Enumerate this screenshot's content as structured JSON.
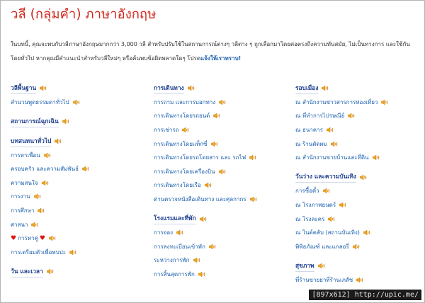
{
  "page": {
    "title": "วลี (กลุ่มคำ) ภาษาอังกฤษ",
    "intro_text": "ในบทนี้, คุณจะพบกับวลีภาษาอังกฤษมากกว่า 3,000 วลี สำหรับปรับใช้ในสถานการณ์ต่างๆ วลีต่าง ๆ ถูกเลือกมาโดยต่อตรงถึงความทันสมัย, ไม่เป็นทางการ และใช้กันโดยทั่วไป หากคุณมีคำแนะนำสำหรับวลีใหม่ๆ หรือค้นพบข้อผิดพลาดใดๆ โปรด",
    "report_link": "แจ้งให้เราทราบ!",
    "speaker_icon": "speaker-icon",
    "heading_color": "#1f3f8f",
    "link_color": "#1a5fae",
    "title_color": "#d0281e"
  },
  "columns": {
    "col1": {
      "h1": "วลีพื้นฐาน",
      "l1": "สำนวนพูดธรรมดาทั่วไป",
      "h2": "สถานการณ์ฉุกเฉิน",
      "h3": "บทสนทนาทั่วไป",
      "l2": "การหาเพื่อน",
      "l3": "ครอบครัว และความสัมพันธ์",
      "l4": "ความสนใจ",
      "l5": "การงาน",
      "l6": "การศึกษา",
      "l7": "ศาสนา",
      "l8": "การหาคู่",
      "l9": "การเตรียมตัวเพื่อพบปะ",
      "h4": "วัน และเวลา"
    },
    "col2": {
      "h1": "การเดินทาง",
      "l1": "การถาม และการบอกทาง",
      "l2": "การเดินทางโดยรถยนต์",
      "l3": "การเช่ารถ",
      "l4": "การเดินทางโดยแท็กซี่",
      "l5": "การเดินทางโดยรถโดยสาร และ รถไฟ",
      "l6": "การเดินทางโดยเครื่องบิน",
      "l7": "การเดินทางโดยเรือ",
      "l8": "ด่านตรวจหนังสือเดินทาง และศุลกากร",
      "h2": "โรงแรมและที่พัก",
      "l9": "การจอง",
      "l10": "การลงทะเบียนเข้าพัก",
      "l11": "ระหว่างการพัก",
      "l12": "การสิ้นสุดการพัก"
    },
    "col3": {
      "h1": "รอบเมือง",
      "l1": "ณ สำนักงานข่าวสารการท่องเที่ยว",
      "l2": "ณ ที่ทำการไปรษณีย์",
      "l3": "ณ ธนาคาร",
      "l4": "ณ ร้านตัดผม",
      "l5": "ณ สำนักงานขายบ้านและที่ดิน",
      "h2": "วันว่าง และความบันเทิง",
      "l6": "การซื้อตั๋ว",
      "l7": "ณ โรงภาพยนตร์",
      "l8": "ณ โรงละคร",
      "l9": "ณ ไนต์คลับ (สถานบันเทิง)",
      "l10": "พิพิธภัณฑ์ และแกลอรี่",
      "h3": "สุขภาพ",
      "l11": "ที่ร้านขายยาที่ร้านเภสัช"
    }
  },
  "watermark": "[897x612] http://upic.me/"
}
